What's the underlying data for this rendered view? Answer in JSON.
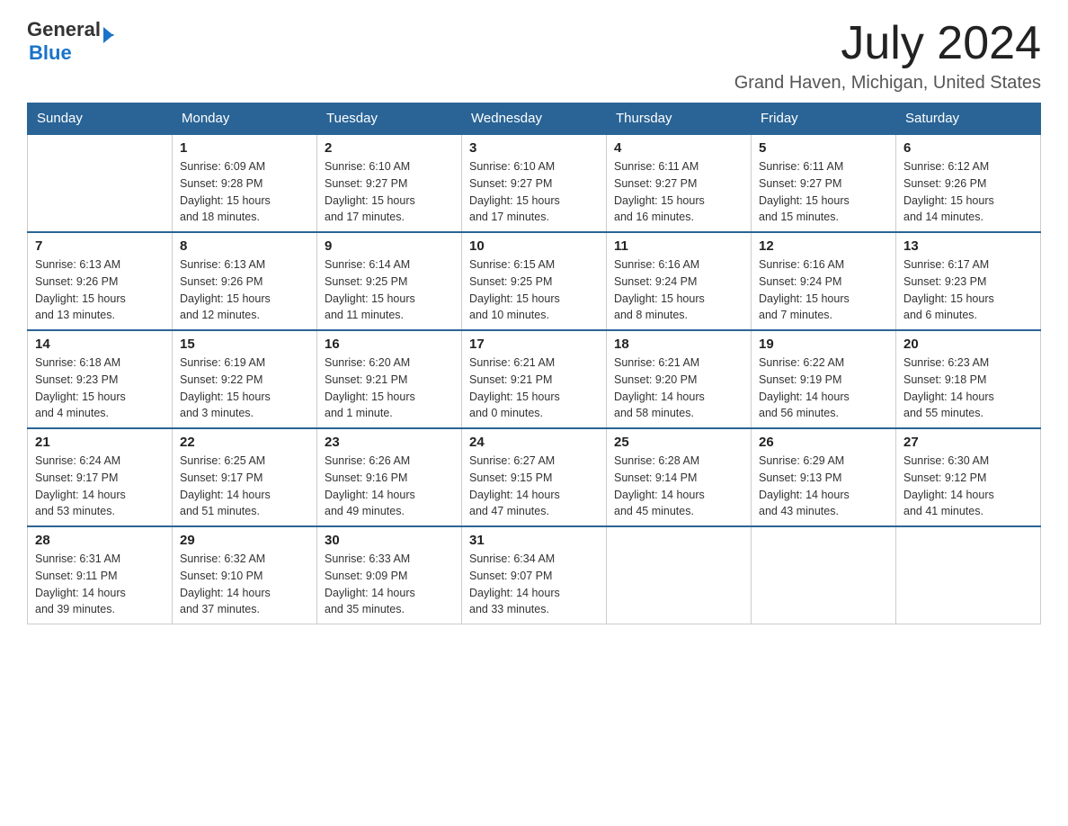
{
  "header": {
    "logo_general": "General",
    "logo_blue": "Blue",
    "month_year": "July 2024",
    "location": "Grand Haven, Michigan, United States"
  },
  "days_of_week": [
    "Sunday",
    "Monday",
    "Tuesday",
    "Wednesday",
    "Thursday",
    "Friday",
    "Saturday"
  ],
  "weeks": [
    [
      {
        "day": "",
        "info": ""
      },
      {
        "day": "1",
        "info": "Sunrise: 6:09 AM\nSunset: 9:28 PM\nDaylight: 15 hours\nand 18 minutes."
      },
      {
        "day": "2",
        "info": "Sunrise: 6:10 AM\nSunset: 9:27 PM\nDaylight: 15 hours\nand 17 minutes."
      },
      {
        "day": "3",
        "info": "Sunrise: 6:10 AM\nSunset: 9:27 PM\nDaylight: 15 hours\nand 17 minutes."
      },
      {
        "day": "4",
        "info": "Sunrise: 6:11 AM\nSunset: 9:27 PM\nDaylight: 15 hours\nand 16 minutes."
      },
      {
        "day": "5",
        "info": "Sunrise: 6:11 AM\nSunset: 9:27 PM\nDaylight: 15 hours\nand 15 minutes."
      },
      {
        "day": "6",
        "info": "Sunrise: 6:12 AM\nSunset: 9:26 PM\nDaylight: 15 hours\nand 14 minutes."
      }
    ],
    [
      {
        "day": "7",
        "info": "Sunrise: 6:13 AM\nSunset: 9:26 PM\nDaylight: 15 hours\nand 13 minutes."
      },
      {
        "day": "8",
        "info": "Sunrise: 6:13 AM\nSunset: 9:26 PM\nDaylight: 15 hours\nand 12 minutes."
      },
      {
        "day": "9",
        "info": "Sunrise: 6:14 AM\nSunset: 9:25 PM\nDaylight: 15 hours\nand 11 minutes."
      },
      {
        "day": "10",
        "info": "Sunrise: 6:15 AM\nSunset: 9:25 PM\nDaylight: 15 hours\nand 10 minutes."
      },
      {
        "day": "11",
        "info": "Sunrise: 6:16 AM\nSunset: 9:24 PM\nDaylight: 15 hours\nand 8 minutes."
      },
      {
        "day": "12",
        "info": "Sunrise: 6:16 AM\nSunset: 9:24 PM\nDaylight: 15 hours\nand 7 minutes."
      },
      {
        "day": "13",
        "info": "Sunrise: 6:17 AM\nSunset: 9:23 PM\nDaylight: 15 hours\nand 6 minutes."
      }
    ],
    [
      {
        "day": "14",
        "info": "Sunrise: 6:18 AM\nSunset: 9:23 PM\nDaylight: 15 hours\nand 4 minutes."
      },
      {
        "day": "15",
        "info": "Sunrise: 6:19 AM\nSunset: 9:22 PM\nDaylight: 15 hours\nand 3 minutes."
      },
      {
        "day": "16",
        "info": "Sunrise: 6:20 AM\nSunset: 9:21 PM\nDaylight: 15 hours\nand 1 minute."
      },
      {
        "day": "17",
        "info": "Sunrise: 6:21 AM\nSunset: 9:21 PM\nDaylight: 15 hours\nand 0 minutes."
      },
      {
        "day": "18",
        "info": "Sunrise: 6:21 AM\nSunset: 9:20 PM\nDaylight: 14 hours\nand 58 minutes."
      },
      {
        "day": "19",
        "info": "Sunrise: 6:22 AM\nSunset: 9:19 PM\nDaylight: 14 hours\nand 56 minutes."
      },
      {
        "day": "20",
        "info": "Sunrise: 6:23 AM\nSunset: 9:18 PM\nDaylight: 14 hours\nand 55 minutes."
      }
    ],
    [
      {
        "day": "21",
        "info": "Sunrise: 6:24 AM\nSunset: 9:17 PM\nDaylight: 14 hours\nand 53 minutes."
      },
      {
        "day": "22",
        "info": "Sunrise: 6:25 AM\nSunset: 9:17 PM\nDaylight: 14 hours\nand 51 minutes."
      },
      {
        "day": "23",
        "info": "Sunrise: 6:26 AM\nSunset: 9:16 PM\nDaylight: 14 hours\nand 49 minutes."
      },
      {
        "day": "24",
        "info": "Sunrise: 6:27 AM\nSunset: 9:15 PM\nDaylight: 14 hours\nand 47 minutes."
      },
      {
        "day": "25",
        "info": "Sunrise: 6:28 AM\nSunset: 9:14 PM\nDaylight: 14 hours\nand 45 minutes."
      },
      {
        "day": "26",
        "info": "Sunrise: 6:29 AM\nSunset: 9:13 PM\nDaylight: 14 hours\nand 43 minutes."
      },
      {
        "day": "27",
        "info": "Sunrise: 6:30 AM\nSunset: 9:12 PM\nDaylight: 14 hours\nand 41 minutes."
      }
    ],
    [
      {
        "day": "28",
        "info": "Sunrise: 6:31 AM\nSunset: 9:11 PM\nDaylight: 14 hours\nand 39 minutes."
      },
      {
        "day": "29",
        "info": "Sunrise: 6:32 AM\nSunset: 9:10 PM\nDaylight: 14 hours\nand 37 minutes."
      },
      {
        "day": "30",
        "info": "Sunrise: 6:33 AM\nSunset: 9:09 PM\nDaylight: 14 hours\nand 35 minutes."
      },
      {
        "day": "31",
        "info": "Sunrise: 6:34 AM\nSunset: 9:07 PM\nDaylight: 14 hours\nand 33 minutes."
      },
      {
        "day": "",
        "info": ""
      },
      {
        "day": "",
        "info": ""
      },
      {
        "day": "",
        "info": ""
      }
    ]
  ]
}
